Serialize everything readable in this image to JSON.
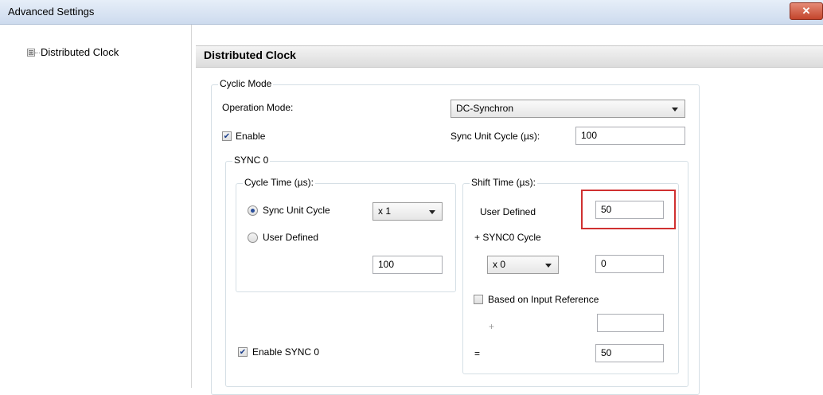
{
  "window": {
    "title": "Advanced Settings",
    "close_glyph": "✕"
  },
  "tree": {
    "expander_glyph": "⊞",
    "item_label": "Distributed Clock"
  },
  "panel": {
    "title": "Distributed Clock"
  },
  "cyclic": {
    "legend": "Cyclic Mode",
    "operation_label": "Operation Mode:",
    "operation_value": "DC-Synchron",
    "enable_label": "Enable",
    "enable_checked": true,
    "sync_unit_label": "Sync Unit Cycle (µs):",
    "sync_unit_value": "100"
  },
  "sync0": {
    "legend": "SYNC 0",
    "cycle_time": {
      "legend": "Cycle Time (µs):",
      "sync_unit_cycle_label": "Sync Unit Cycle",
      "sync_unit_cycle_selected": true,
      "multiplier_value": "x 1",
      "user_defined_label": "User Defined",
      "value": "100"
    },
    "shift_time": {
      "legend": "Shift Time (µs):",
      "user_defined_label": "User Defined",
      "user_defined_value": "50",
      "sync0_cycle_label": "+ SYNC0 Cycle",
      "sync0_multiplier": "x 0",
      "sync0_value": "0",
      "input_ref_label": "Based on Input Reference",
      "input_ref_checked": false,
      "plus_label": "+",
      "plus_value": "",
      "equals_label": "=",
      "equals_value": "50"
    },
    "enable_sync0_label": "Enable SYNC 0",
    "enable_sync0_checked": true
  },
  "icons": {
    "check": "check-icon",
    "close": "close-icon",
    "expand": "plus-box-icon",
    "dropdown": "chevron-down-icon"
  },
  "colors": {
    "highlight": "#d03030",
    "titlebar": "#cddbee"
  }
}
